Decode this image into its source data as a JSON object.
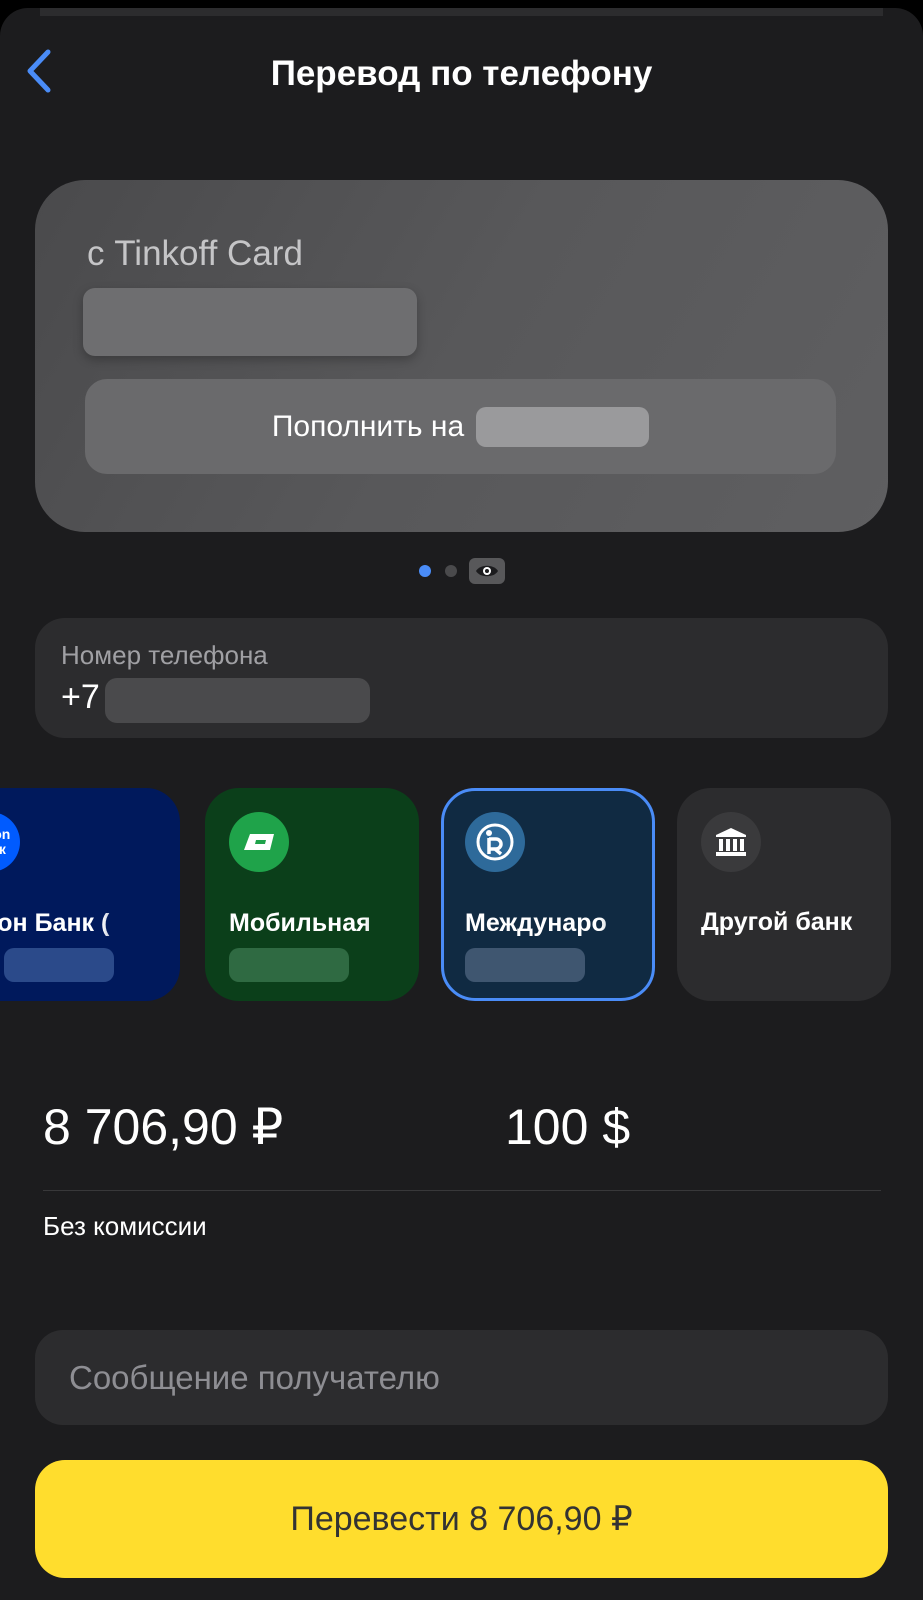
{
  "header": {
    "back_icon": "chevron-left-icon",
    "title": "Перевод по телефону"
  },
  "source_card": {
    "label": "с Tinkoff Card",
    "topup_label": "Пополнить на"
  },
  "carousel": {
    "pages": 2,
    "active_index": 0,
    "eye_icon": "eye-icon"
  },
  "phone": {
    "label": "Номер телефона",
    "prefix": "+7"
  },
  "banks": [
    {
      "name": "Озон Банк (",
      "icon_text": "ozon банк",
      "selected": false
    },
    {
      "name": "Мобильная",
      "icon": "ticket-icon",
      "selected": false
    },
    {
      "name": "Междунаро",
      "icon": "r-logo-icon",
      "selected": true
    },
    {
      "name": "Другой банк",
      "icon": "bank-building-icon",
      "selected": false
    }
  ],
  "amount": {
    "rub": "8 706,90 ₽",
    "usd": "100 $",
    "fee": "Без комиссии"
  },
  "message": {
    "placeholder": "Сообщение получателю"
  },
  "submit": {
    "label": "Перевести 8 706,90 ₽"
  },
  "colors": {
    "background": "#1c1c1e",
    "accent_blue": "#4a8cf7",
    "submit_yellow": "#ffdd2d"
  }
}
